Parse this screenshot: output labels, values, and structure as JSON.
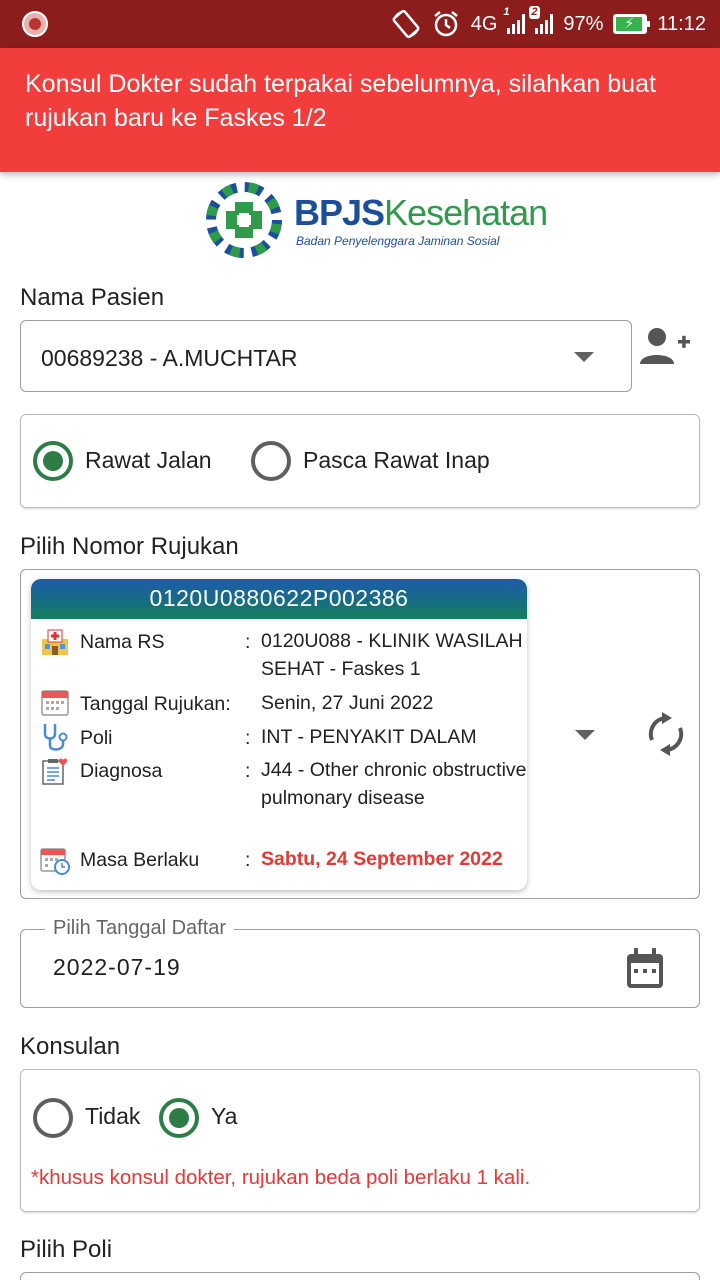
{
  "status_bar": {
    "network": "4G",
    "sim2_badge": "2",
    "sim1_badge": "1",
    "battery": "97%",
    "time": "11:12"
  },
  "toast": {
    "message": "Konsul Dokter sudah terpakai sebelumnya, silahkan buat rujukan baru ke Faskes 1/2"
  },
  "logo": {
    "brand_bold": "BPJS",
    "brand_light": "Kesehatan",
    "tagline": "Badan Penyelenggara Jaminan Sosial"
  },
  "patient": {
    "label": "Nama Pasien",
    "selected": "00689238 - A.MUCHTAR"
  },
  "care_type": {
    "options": [
      "Rawat Jalan",
      "Pasca Rawat Inap"
    ],
    "selected": "Rawat Jalan"
  },
  "rujukan": {
    "label": "Pilih Nomor Rujukan",
    "number": "0120U0880622P002386",
    "rows": [
      {
        "key": "Nama RS",
        "value": "0120U088 - KLINIK WASILAH SEHAT - Faskes 1"
      },
      {
        "key": "Tanggal Rujukan:",
        "value": "Senin, 27 Juni 2022"
      },
      {
        "key": "Poli",
        "value": "INT - PENYAKIT DALAM"
      },
      {
        "key": "Diagnosa",
        "value": "J44 - Other chronic obstructive pulmonary disease"
      },
      {
        "key": "Masa Berlaku",
        "value": "Sabtu, 24 September 2022"
      }
    ],
    "colon": ":"
  },
  "tanggal": {
    "legend": "Pilih Tanggal Daftar",
    "value": "2022-07-19"
  },
  "konsulan": {
    "label": "Konsulan",
    "options": [
      "Tidak",
      "Ya"
    ],
    "selected": "Ya",
    "note": "*khusus konsul dokter, rujukan beda poli berlaku 1 kali."
  },
  "poli": {
    "label": "Pilih Poli"
  },
  "colors": {
    "status_bar": "#8b1d1d",
    "toast": "#f23d3d",
    "accent_green": "#2e7d46",
    "warning_red": "#e53935"
  }
}
